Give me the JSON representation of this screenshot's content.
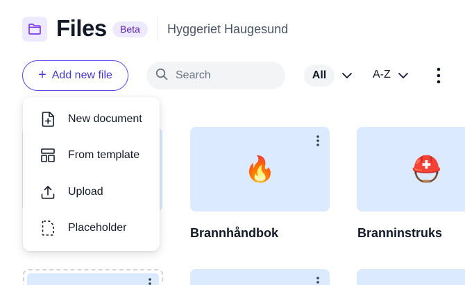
{
  "header": {
    "title": "Files",
    "badge": "Beta",
    "organization": "Hyggeriet Haugesund",
    "app_icon": "folder-icon"
  },
  "toolbar": {
    "add_label": "Add new file",
    "search_placeholder": "Search",
    "filter_value": "All",
    "sort_value": "A-Z"
  },
  "menu": {
    "items": [
      {
        "label": "New document",
        "icon": "new-document-icon"
      },
      {
        "label": "From template",
        "icon": "template-icon"
      },
      {
        "label": "Upload",
        "icon": "upload-icon"
      },
      {
        "label": "Placeholder",
        "icon": "placeholder-icon"
      }
    ]
  },
  "files": [
    {
      "name": "Brannhåndbok",
      "emoji": "🔥"
    },
    {
      "name": "Branninstruks",
      "emoji": "⛑️"
    }
  ],
  "colors": {
    "accent": "#4f46e5",
    "card_bg": "#dbeafe",
    "badge_bg": "#ede9fe"
  }
}
